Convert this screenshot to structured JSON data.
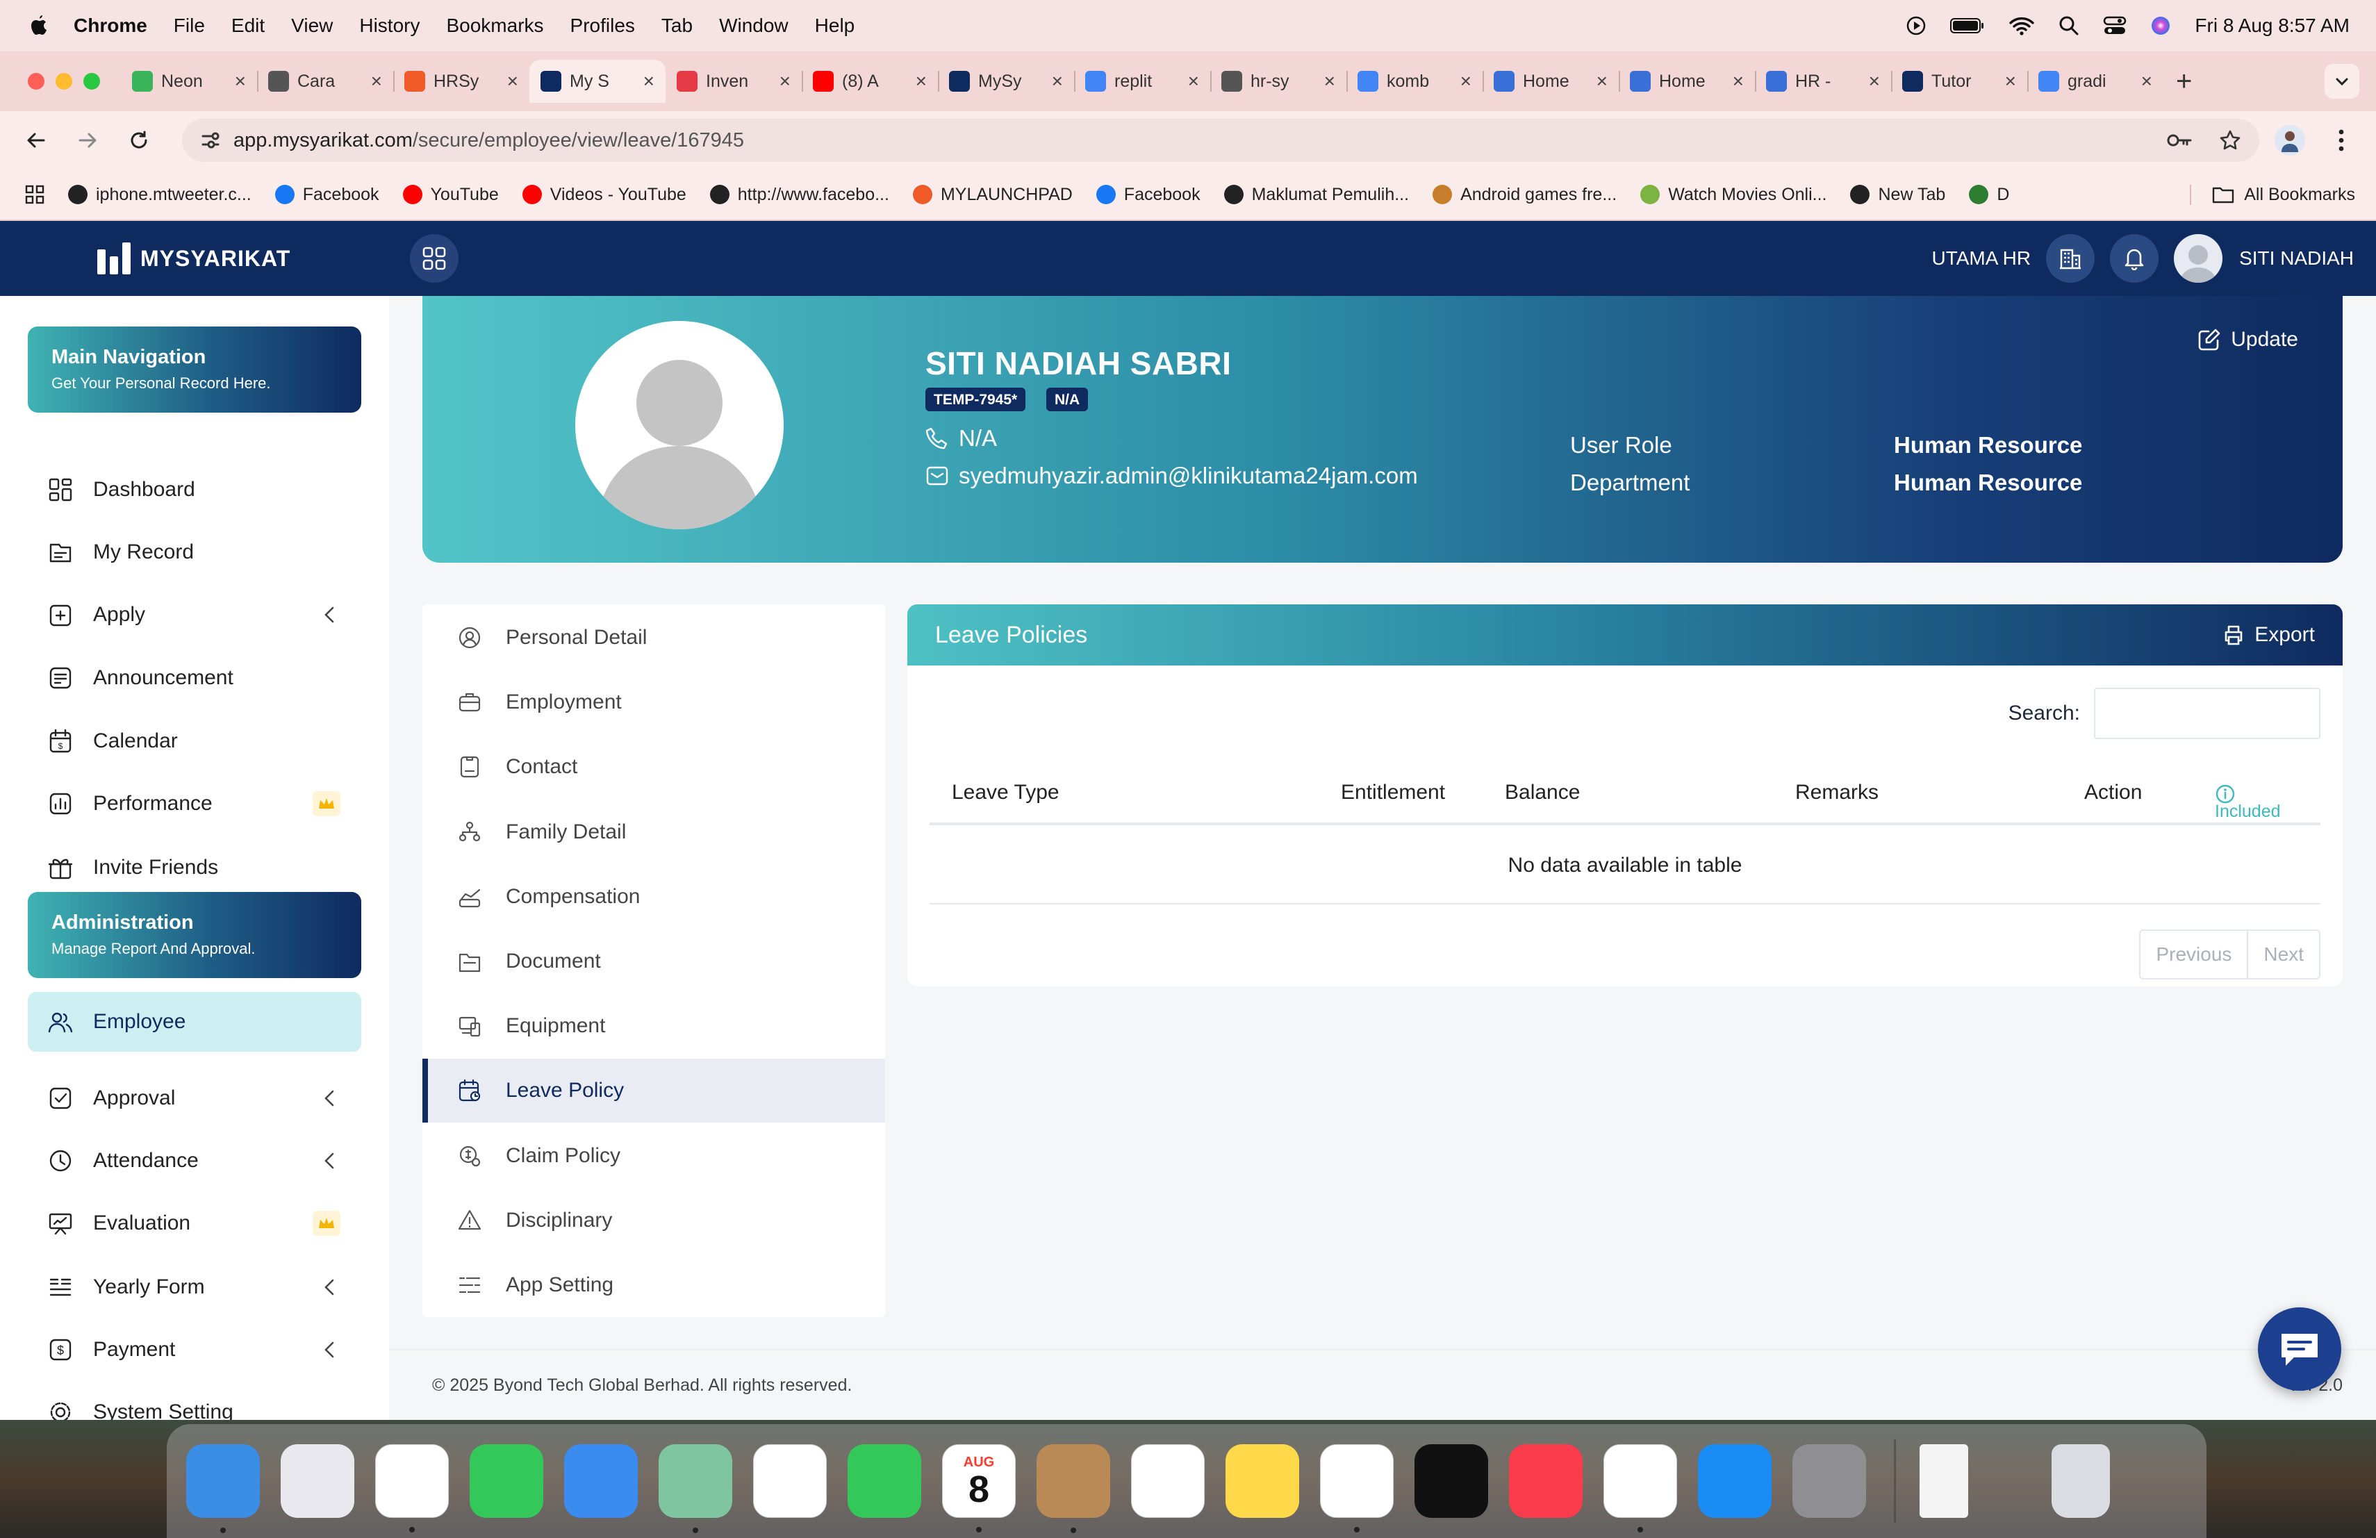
{
  "menubar": {
    "app": "Chrome",
    "items": [
      "File",
      "Edit",
      "View",
      "History",
      "Bookmarks",
      "Profiles",
      "Tab",
      "Window",
      "Help"
    ],
    "datetime": "Fri 8 Aug  8:57 AM"
  },
  "tabs": [
    {
      "title": "Neon",
      "color": "#3bb55b"
    },
    {
      "title": "Cara",
      "color": "#555555"
    },
    {
      "title": "HRSy",
      "color": "#f05a28"
    },
    {
      "title": "My S",
      "color": "#0f2a5f",
      "active": true
    },
    {
      "title": "Inven",
      "color": "#e63946"
    },
    {
      "title": "(8) A",
      "color": "#ff0000"
    },
    {
      "title": "MySy",
      "color": "#0f2a5f"
    },
    {
      "title": "replit",
      "color": "#4285f4"
    },
    {
      "title": "hr-sy",
      "color": "#555555"
    },
    {
      "title": "komb",
      "color": "#4285f4"
    },
    {
      "title": "Home",
      "color": "#3b6fd8"
    },
    {
      "title": "Home",
      "color": "#3b6fd8"
    },
    {
      "title": "HR -",
      "color": "#3b6fd8"
    },
    {
      "title": "Tutor",
      "color": "#0f2a5f"
    },
    {
      "title": "gradi",
      "color": "#4285f4"
    }
  ],
  "address": {
    "host": "app.mysyarikat.com",
    "path": "/secure/employee/view/leave/167945"
  },
  "bookmarks": [
    {
      "label": "iphone.mtweeter.c...",
      "color": "#222222"
    },
    {
      "label": "Facebook",
      "color": "#1877f2"
    },
    {
      "label": "YouTube",
      "color": "#ff0000"
    },
    {
      "label": "Videos - YouTube",
      "color": "#ff0000"
    },
    {
      "label": "http://www.facebo...",
      "color": "#222222"
    },
    {
      "label": "MYLAUNCHPAD",
      "color": "#f05a28"
    },
    {
      "label": "Facebook",
      "color": "#1877f2"
    },
    {
      "label": "Maklumat Pemulih...",
      "color": "#222222"
    },
    {
      "label": "Android games fre...",
      "color": "#c77d2a"
    },
    {
      "label": "Watch Movies Onli...",
      "color": "#7cb342"
    },
    {
      "label": "New Tab",
      "color": "#222222"
    },
    {
      "label": "D",
      "color": "#2e7d32"
    }
  ],
  "all_bookmarks": "All Bookmarks",
  "app": {
    "logo": "MYSYARIKAT",
    "company": "UTAMA HR",
    "user": "SITI NADIAH"
  },
  "sidebar": {
    "main_card": {
      "title": "Main Navigation",
      "subtitle": "Get Your Personal Record Here."
    },
    "items": [
      {
        "label": "Dashboard"
      },
      {
        "label": "My Record"
      },
      {
        "label": "Apply",
        "chevron": true
      },
      {
        "label": "Announcement"
      },
      {
        "label": "Calendar"
      },
      {
        "label": "Performance",
        "crown": true
      },
      {
        "label": "Invite Friends"
      }
    ],
    "admin_card": {
      "title": "Administration",
      "subtitle": "Manage Report And Approval."
    },
    "admin_items": [
      {
        "label": "Employee",
        "selected": true
      },
      {
        "label": "Approval",
        "chevron": true
      },
      {
        "label": "Attendance",
        "chevron": true
      },
      {
        "label": "Evaluation",
        "crown": true
      },
      {
        "label": "Yearly Form",
        "chevron": true
      },
      {
        "label": "Payment",
        "chevron": true
      },
      {
        "label": "System Setting"
      }
    ]
  },
  "profile": {
    "name": "SITI NADIAH SABRI",
    "badge1": "TEMP-7945*",
    "badge2": "N/A",
    "phone": "N/A",
    "email": "syedmuhyazir.admin@klinikutama24jam.com",
    "role_label": "User Role",
    "role_value": "Human Resource",
    "dept_label": "Department",
    "dept_value": "Human Resource",
    "update": "Update"
  },
  "subnav": [
    {
      "label": "Personal Detail"
    },
    {
      "label": "Employment"
    },
    {
      "label": "Contact"
    },
    {
      "label": "Family Detail"
    },
    {
      "label": "Compensation"
    },
    {
      "label": "Document"
    },
    {
      "label": "Equipment"
    },
    {
      "label": "Leave Policy",
      "selected": true
    },
    {
      "label": "Claim Policy"
    },
    {
      "label": "Disciplinary"
    },
    {
      "label": "App Setting"
    }
  ],
  "leave": {
    "title": "Leave Policies",
    "export": "Export",
    "search_label": "Search:",
    "search_value": "",
    "columns": [
      "Leave Type",
      "Entitlement",
      "Balance",
      "Remarks",
      "Action"
    ],
    "included": "Included",
    "empty": "No data available in table",
    "prev": "Previous",
    "next": "Next"
  },
  "footer": {
    "copyright": "© 2025 Byond Tech Global Berhad. All rights reserved.",
    "version": "Ver   2.0"
  },
  "dock": {
    "calendar_month": "AUG",
    "calendar_day": "8",
    "apps": [
      {
        "name": "finder",
        "color": "#3a8ee6"
      },
      {
        "name": "launchpad",
        "color": "#e8e8ee"
      },
      {
        "name": "safari",
        "color": "#ffffff"
      },
      {
        "name": "messages",
        "color": "#34c759"
      },
      {
        "name": "mail",
        "color": "#3b8cf0"
      },
      {
        "name": "maps",
        "color": "#7fc5a0"
      },
      {
        "name": "photos",
        "color": "#ffffff"
      },
      {
        "name": "facetime",
        "color": "#34c759"
      },
      {
        "name": "calendar",
        "color": "#ffffff"
      },
      {
        "name": "contacts",
        "color": "#b98a55"
      },
      {
        "name": "reminders",
        "color": "#ffffff"
      },
      {
        "name": "notes",
        "color": "#ffd94a"
      },
      {
        "name": "freeform",
        "color": "#ffffff"
      },
      {
        "name": "tv",
        "color": "#111111"
      },
      {
        "name": "music",
        "color": "#fa3c4c"
      },
      {
        "name": "chrome",
        "color": "#ffffff"
      },
      {
        "name": "app-store",
        "color": "#1a8cf5"
      },
      {
        "name": "system-settings",
        "color": "#8e8e93"
      }
    ]
  }
}
